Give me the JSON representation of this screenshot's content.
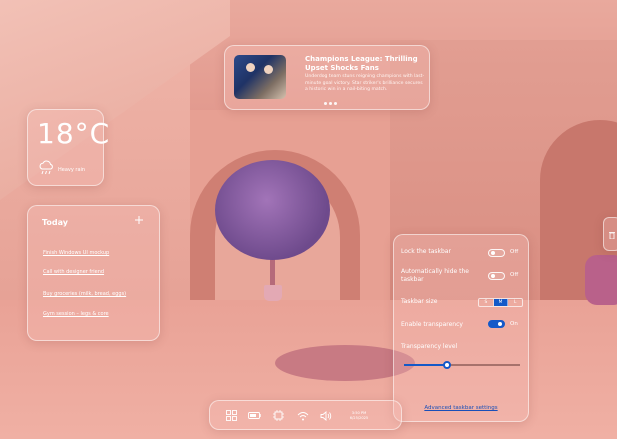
{
  "news": {
    "title": "Champions League: Thrilling Upset Shocks Fans",
    "description": "Underdog team stuns reigning champions with last-minute goal victory. Star striker's brilliance secures a historic win in a nail-biting match.",
    "page_count": 3
  },
  "weather": {
    "temperature": "18°C",
    "condition": "Heavy rain",
    "icon": "rain-cloud-icon"
  },
  "today": {
    "title": "Today",
    "tasks": [
      "Finish Windows UI mockup",
      "Call with designer friend",
      "Buy groceries (milk, bread, eggs)",
      "Gym session – legs & core"
    ]
  },
  "taskbar": {
    "icons": [
      "widgets-icon",
      "battery-icon",
      "chip-icon",
      "wifi-icon",
      "volume-icon"
    ],
    "time": "3:50 PM",
    "date": "6/25/2025"
  },
  "settings": {
    "lock_label": "Lock the taskbar",
    "lock_state": "Off",
    "autohide_label": "Automatically hide the taskbar",
    "autohide_state": "Off",
    "size_label": "Taskbar size",
    "size_options": [
      "S",
      "M",
      "L"
    ],
    "size_selected": "M",
    "transparency_label": "Enable transparency",
    "transparency_state": "On",
    "level_label": "Transparency level",
    "level_value": 0.37,
    "advanced_link": "Advanced taskbar settings"
  },
  "colors": {
    "accent": "#1459c8",
    "wallpaper": "#e39c90"
  }
}
